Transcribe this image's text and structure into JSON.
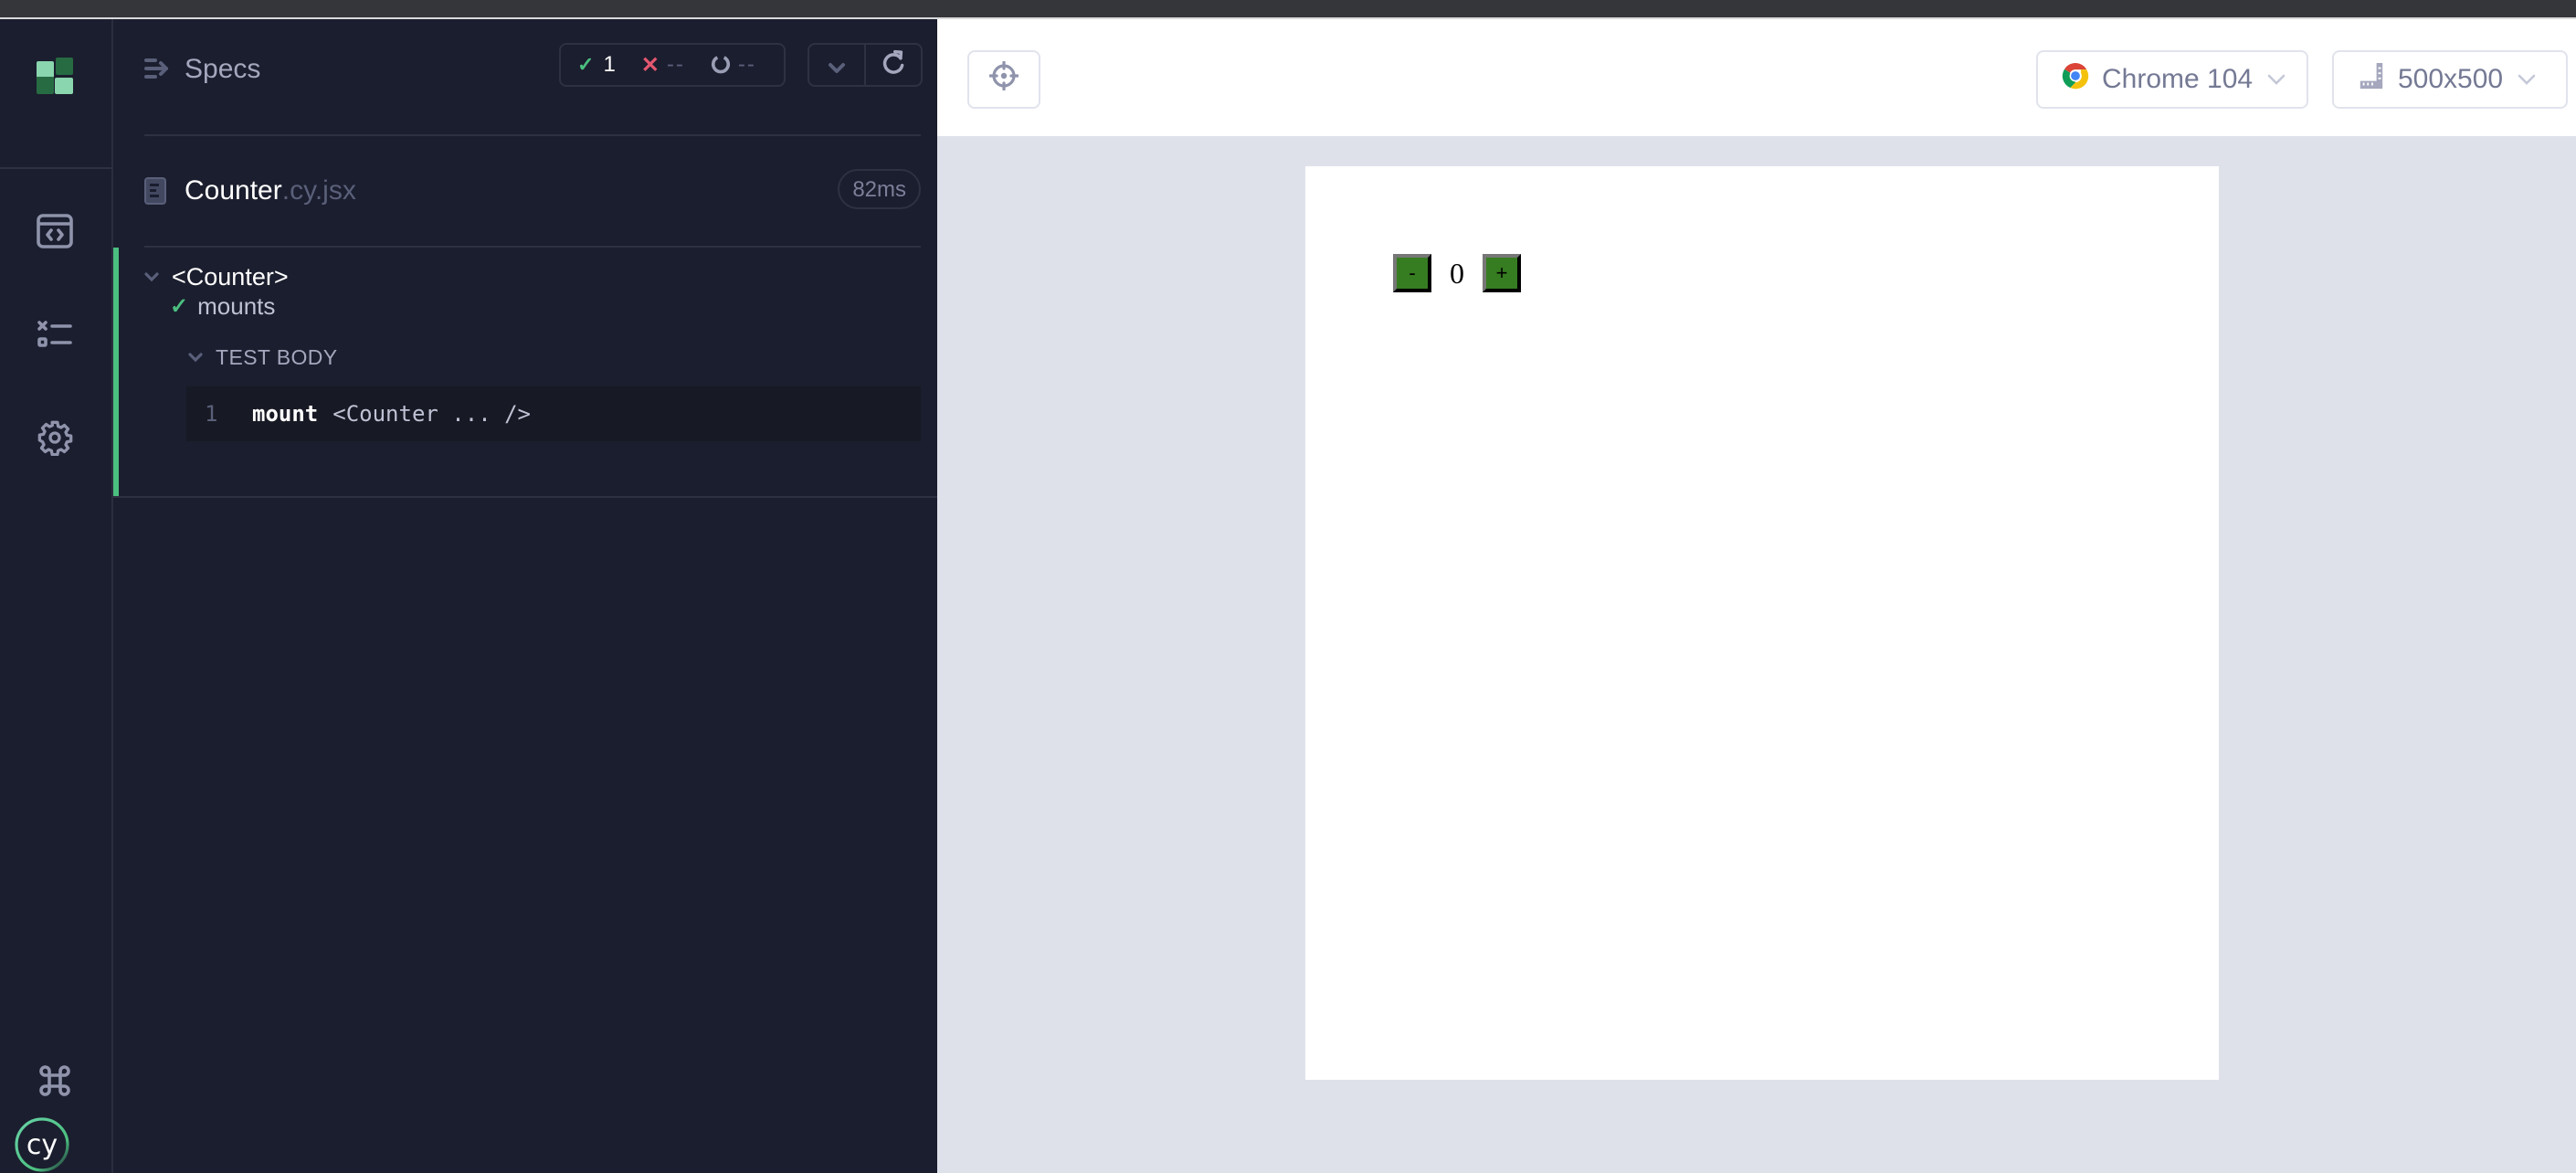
{
  "sidebar": {
    "logo": "cypress-app-logo-icon",
    "nav_items": [
      {
        "name": "specs",
        "icon": "code-window-icon"
      },
      {
        "name": "runs",
        "icon": "test-results-icon"
      },
      {
        "name": "settings",
        "icon": "gear-icon"
      }
    ],
    "footer_items": [
      {
        "name": "keyboard-shortcuts",
        "icon": "command-key-icon"
      },
      {
        "name": "cypress",
        "icon": "cypress-logo-icon",
        "label": "cy"
      }
    ]
  },
  "specs_panel": {
    "title": "Specs",
    "stats": {
      "passed": "1",
      "failed": "--",
      "pending": "--"
    },
    "spec_file": {
      "name": "Counter",
      "extension": ".cy.jsx",
      "duration": "82ms"
    },
    "suite": {
      "title": "<Counter>",
      "tests": [
        {
          "title": "mounts",
          "state": "passed",
          "section_label": "TEST BODY",
          "commands": [
            {
              "number": "1",
              "method": "mount",
              "message": "<Counter ... />"
            }
          ]
        }
      ]
    }
  },
  "aut": {
    "browser": "Chrome 104",
    "viewport": "500x500",
    "app": {
      "decrement_label": "-",
      "count": "0",
      "increment_label": "+"
    }
  },
  "colors": {
    "pass": "#4bbf7f",
    "fail": "#e45770",
    "panel_bg": "#1b1e2e",
    "aut_bg": "#dfe1ea",
    "counter_button": "#367c21"
  }
}
